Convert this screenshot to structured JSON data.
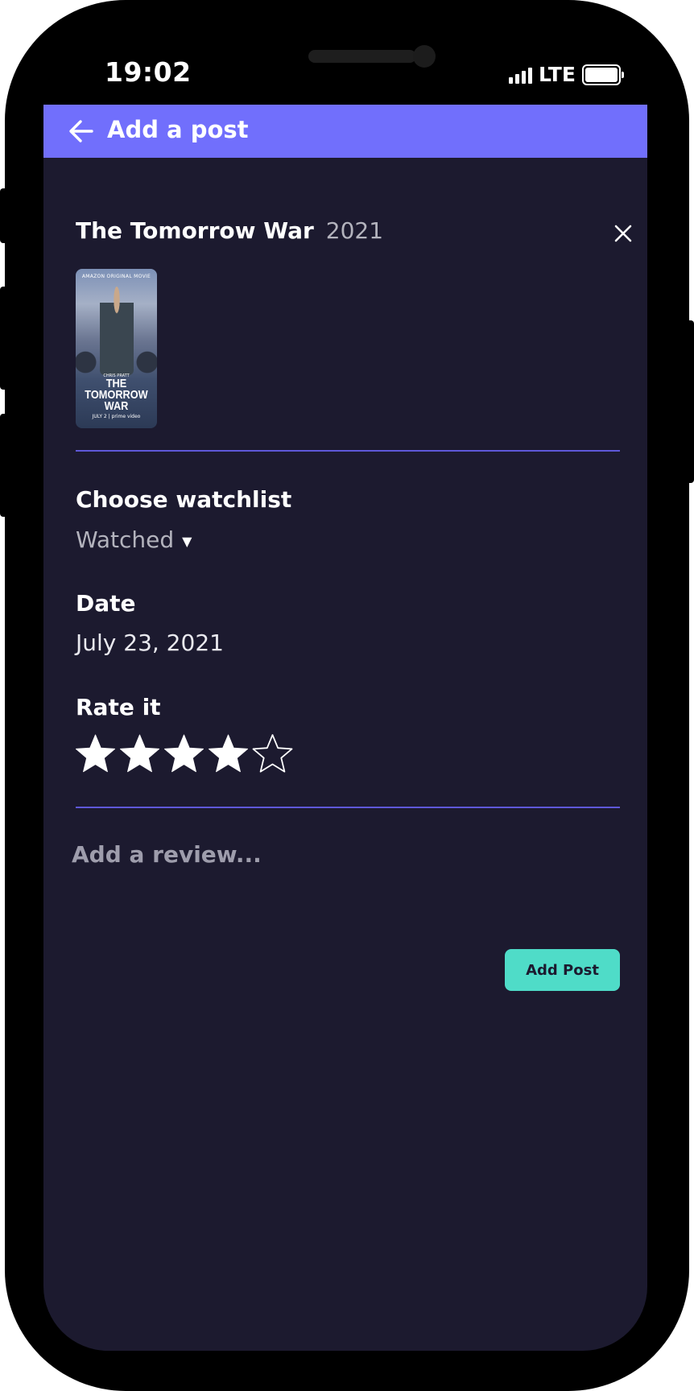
{
  "status_bar": {
    "time": "19:02",
    "network": "LTE"
  },
  "header": {
    "title": "Add a post",
    "back_icon": "arrow-left-icon"
  },
  "movie": {
    "title": "The Tomorrow War",
    "year": "2021",
    "close_icon": "close-icon",
    "poster": {
      "top_text": "AMAZON ORIGINAL MOVIE",
      "actor": "CHRIS PRATT",
      "title_line1": "THE",
      "title_line2": "TOMORROW",
      "title_line3": "WAR",
      "footer": "JULY 2 | prime video"
    }
  },
  "watchlist": {
    "label": "Choose watchlist",
    "selected": "Watched"
  },
  "date": {
    "label": "Date",
    "value": "July 23, 2021"
  },
  "rating": {
    "label": "Rate it",
    "value": 4,
    "max": 5
  },
  "review": {
    "placeholder": "Add a review..."
  },
  "actions": {
    "add_post_label": "Add Post"
  },
  "colors": {
    "header": "#716ffc",
    "background": "#1c1a2f",
    "divider": "#5e58d8",
    "button": "#4fdcc8"
  }
}
